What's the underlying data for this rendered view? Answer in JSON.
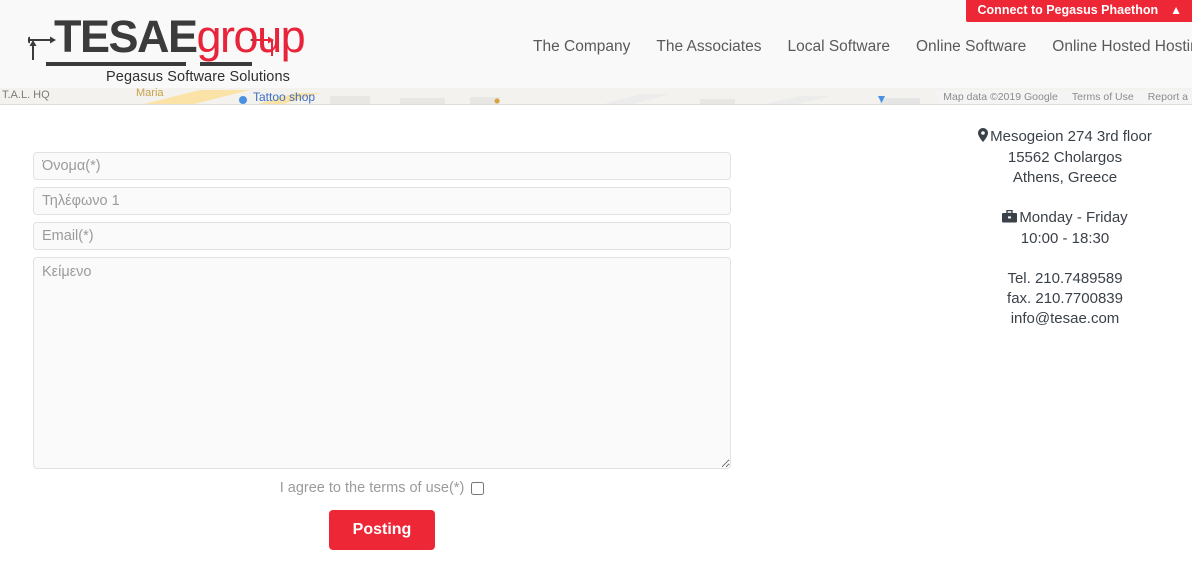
{
  "promo": {
    "label": "Connect to Pegasus Phaethon",
    "caret_icon": "chevron-up-icon",
    "color": "#ee2737"
  },
  "header": {
    "logo": {
      "text_primary": "TESAE",
      "text_secondary": "group",
      "tagline": "Pegasus Software Solutions",
      "primary_color": "#3b3b3b",
      "secondary_color": "#e8243a"
    },
    "nav": [
      {
        "label": "The Company"
      },
      {
        "label": "The Associates"
      },
      {
        "label": "Local Software"
      },
      {
        "label": "Online Software"
      },
      {
        "label": "Online Hosted Hosting"
      }
    ],
    "search_icon": "search-icon"
  },
  "map": {
    "labels": {
      "hq": "T.A.L. HQ",
      "maria": "Maria",
      "tattoo": "Tattoo shop"
    },
    "attribution": [
      "Map data ©2019 Google",
      "Terms of Use",
      "Report a"
    ]
  },
  "form": {
    "name_placeholder": "Όνομα(*)",
    "phone_placeholder": "Τηλέφωνο 1",
    "email_placeholder": "Email(*)",
    "message_placeholder": "Κείμενο",
    "name_value": "",
    "phone_value": "",
    "email_value": "",
    "message_value": "",
    "terms_label": "I agree to the terms of use(*)",
    "terms_checked": false,
    "submit_label": "Posting",
    "submit_color": "#ee2737"
  },
  "contact": {
    "address_icon": "map-pin-icon",
    "address_line1": "Mesogeion 274 3rd floor",
    "address_line2": "15562 Cholargos",
    "address_line3": "Athens, Greece",
    "hours_icon": "briefcase-icon",
    "hours_days": "Monday - Friday",
    "hours_time": "10:00 - 18:30",
    "tel": "Tel. 210.7489589",
    "fax": "fax. 210.7700839",
    "email": "info@tesae.com"
  }
}
